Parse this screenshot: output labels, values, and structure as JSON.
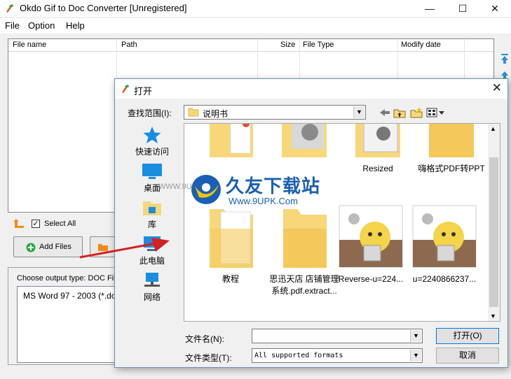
{
  "window": {
    "title": "Okdo Gif to Doc Converter [Unregistered]",
    "minimize": "—",
    "maximize": "☐",
    "close": "✕"
  },
  "menu": [
    "File",
    "Option",
    "Help"
  ],
  "filelist": {
    "columns": [
      "File name",
      "Path",
      "Size",
      "File Type",
      "Modify date"
    ]
  },
  "controls": {
    "select_all": "Select All",
    "select_all_checked": true,
    "add_files": "Add Files",
    "output_type_label": "Choose output type:  DOC Fil",
    "output_type_value": "MS Word 97 - 2003 (*.do"
  },
  "dialog": {
    "title": "打开",
    "look_in_label": "查找范围(I):",
    "look_in_value": "说明书",
    "places": [
      "快速访问",
      "桌面",
      "库",
      "此电脑",
      "网络"
    ],
    "items_top": [
      "",
      "",
      "Resized",
      "嗨格式PDF转PPT"
    ],
    "items_bottom": [
      "教程",
      "思迅天店 店铺管理系统.pdf.extract...",
      "Reverse-u=224...",
      "u=2240866237..."
    ],
    "file_name_label": "文件名(N):",
    "file_name_value": "",
    "file_type_label": "文件类型(T):",
    "file_type_value": "All supported formats",
    "open_button": "打开(O)",
    "cancel_button": "取消"
  },
  "watermark": {
    "brand": "久友下载站",
    "url": "Www.9UPK.Com",
    "behind_text": "WWW.9U"
  },
  "colors": {
    "folder": "#f7d77a",
    "accent_blue": "#0078d7",
    "arrow_red": "#d42020",
    "add_icon_green": "#28a745"
  }
}
